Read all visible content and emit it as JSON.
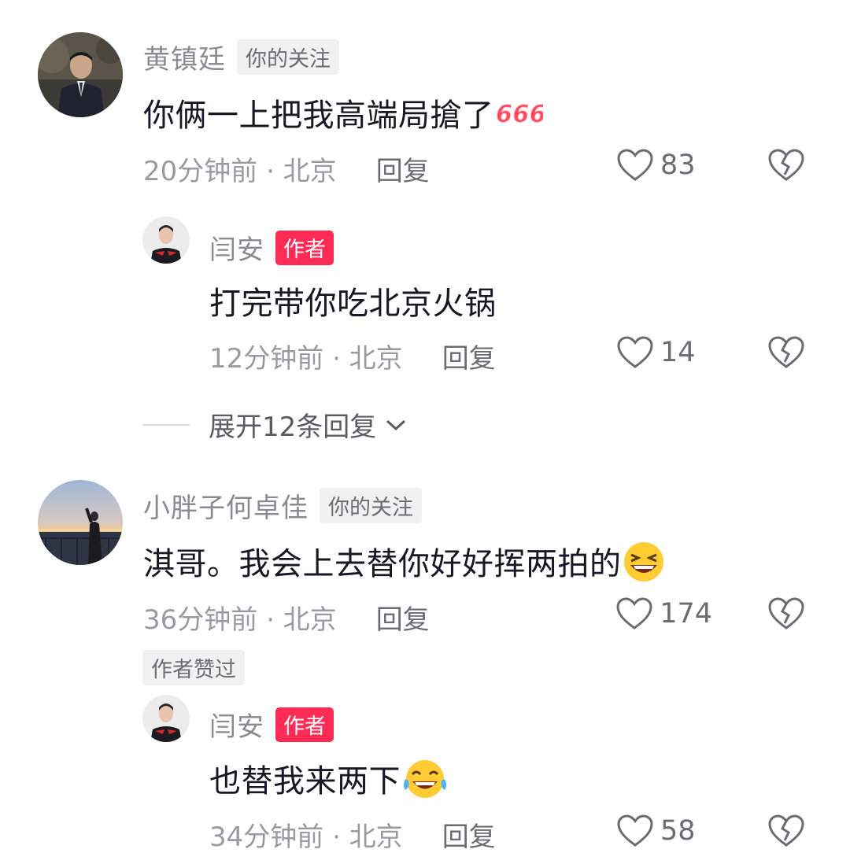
{
  "comments": [
    {
      "user": "黄镇廷",
      "badge": "你的关注",
      "text": "你俩一上把我高端局搶了",
      "emoji_text": "666",
      "time_location": "20分钟前 · 北京",
      "reply_label": "回复",
      "likes": "83",
      "replies": [
        {
          "user": "闫安",
          "badge": "作者",
          "text": "打完带你吃北京火锅",
          "time_location": "12分钟前 · 北京",
          "reply_label": "回复",
          "likes": "14"
        }
      ],
      "expand_label": "展开12条回复"
    },
    {
      "user": "小胖子何卓佳",
      "badge": "你的关注",
      "text": "淇哥。我会上去替你好好挥两拍的",
      "time_location": "36分钟前 · 北京",
      "reply_label": "回复",
      "likes": "174",
      "author_liked": "作者赞过",
      "replies": [
        {
          "user": "闫安",
          "badge": "作者",
          "text": "也替我来两下",
          "time_location": "34分钟前 · 北京",
          "reply_label": "回复",
          "likes": "58"
        }
      ]
    }
  ],
  "colors": {
    "author_badge": "#fe2c55",
    "username": "#8a8b91",
    "text": "#161823",
    "meta": "#9a9ba1"
  },
  "icons": [
    "heart-outline-icon",
    "broken-heart-icon",
    "chevron-down-icon",
    "laughing-emoji-icon",
    "crying-laughing-emoji-icon",
    "666-sticker-icon"
  ]
}
